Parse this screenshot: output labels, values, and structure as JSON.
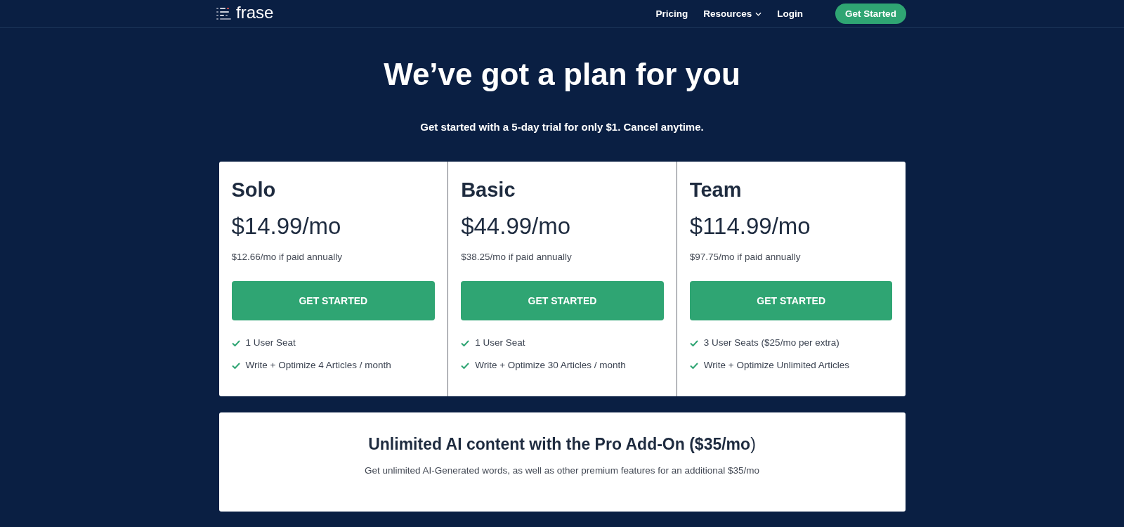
{
  "header": {
    "logo_text": "frase",
    "nav": [
      {
        "label": "Pricing",
        "kind": "link"
      },
      {
        "label": "Resources",
        "kind": "dropdown"
      },
      {
        "label": "Login",
        "kind": "link"
      }
    ],
    "cta": "Get Started"
  },
  "hero": {
    "title": "We’ve got a plan for you",
    "subtitle": "Get started with a 5-day trial for only $1. Cancel anytime."
  },
  "plans": [
    {
      "name": "Solo",
      "price": "$14.99/mo",
      "annual": "$12.66/mo if paid annually",
      "button": "GET STARTED",
      "features": [
        "1 User Seat",
        "Write + Optimize 4 Articles / month"
      ]
    },
    {
      "name": "Basic",
      "price": "$44.99/mo",
      "annual": "$38.25/mo if paid annually",
      "button": "GET STARTED",
      "features": [
        "1 User Seat",
        "Write + Optimize 30 Articles / month"
      ]
    },
    {
      "name": "Team",
      "price": "$114.99/mo",
      "annual": "$97.75/mo if paid annually",
      "button": "GET STARTED",
      "features": [
        "3 User Seats ($25/mo per extra)",
        "Write + Optimize Unlimited Articles"
      ]
    }
  ],
  "addon": {
    "title": "**Unlimited AI content with the Pro Add-On ($35/mo**)",
    "text": "Get unlimited AI-Generated words, as well as other premium features for an additional $35/mo"
  }
}
